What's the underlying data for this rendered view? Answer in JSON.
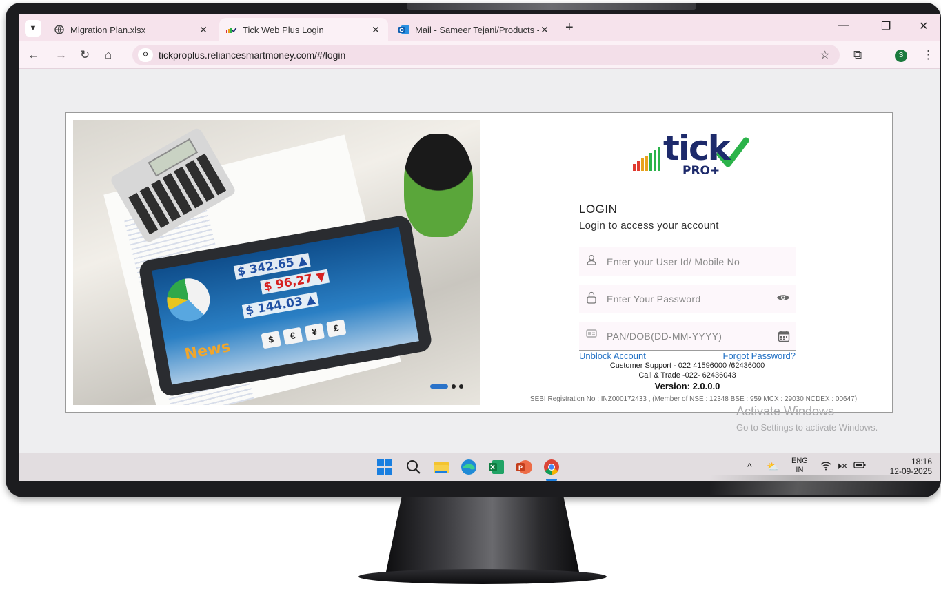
{
  "browser": {
    "tabs": [
      {
        "title": "Migration Plan.xlsx",
        "favicon": "globe-icon",
        "active": false
      },
      {
        "title": "Tick Web Plus Login",
        "favicon": "tick-favicon",
        "active": true
      },
      {
        "title": "Mail - Sameer Tejani/Products -",
        "favicon": "outlook-icon",
        "active": false
      }
    ],
    "new_tab": "+",
    "url": "tickproplus.reliancesmartmoney.com/#/login",
    "profile_initial": "S"
  },
  "hero": {
    "prices": [
      "$ 342.65 ▲",
      "$  96,27 ▼",
      "$ 144.03 ▲"
    ],
    "news_label": "News",
    "currency_symbols": [
      "$",
      "€",
      "¥",
      "£"
    ]
  },
  "logo": {
    "wordmark": "tick",
    "badge": "PRO+"
  },
  "login": {
    "heading": "LOGIN",
    "subheading": "Login to access your account",
    "user_placeholder": "Enter your User Id/ Mobile No",
    "password_placeholder": "Enter Your Password",
    "pan_placeholder": "PAN/DOB(DD-MM-YYYY)",
    "unblock_link": "Unblock Account",
    "forgot_link": "Forgot Password?",
    "support_line": "Customer Support - 022 41596000 /62436000",
    "trade_line": "Call & Trade -022- 62436043",
    "version": "Version: 2.0.0.0",
    "sebi": "SEBI Registration No : INZ000172433 , (Member of NSE : 12348 BSE : 959 MCX : 29030 NCDEX : 00647)"
  },
  "watermark": {
    "title": "Activate Windows",
    "subtitle": "Go to Settings to activate Windows."
  },
  "taskbar": {
    "lang_top": "ENG",
    "lang_bottom": "IN",
    "time": "18:16",
    "date": "12-09-2025"
  },
  "colors": {
    "tabstrip": "#f6e3ec",
    "link": "#1f6fc4",
    "logo_green": "#2bb34a",
    "logo_navy": "#1d2a6b"
  }
}
